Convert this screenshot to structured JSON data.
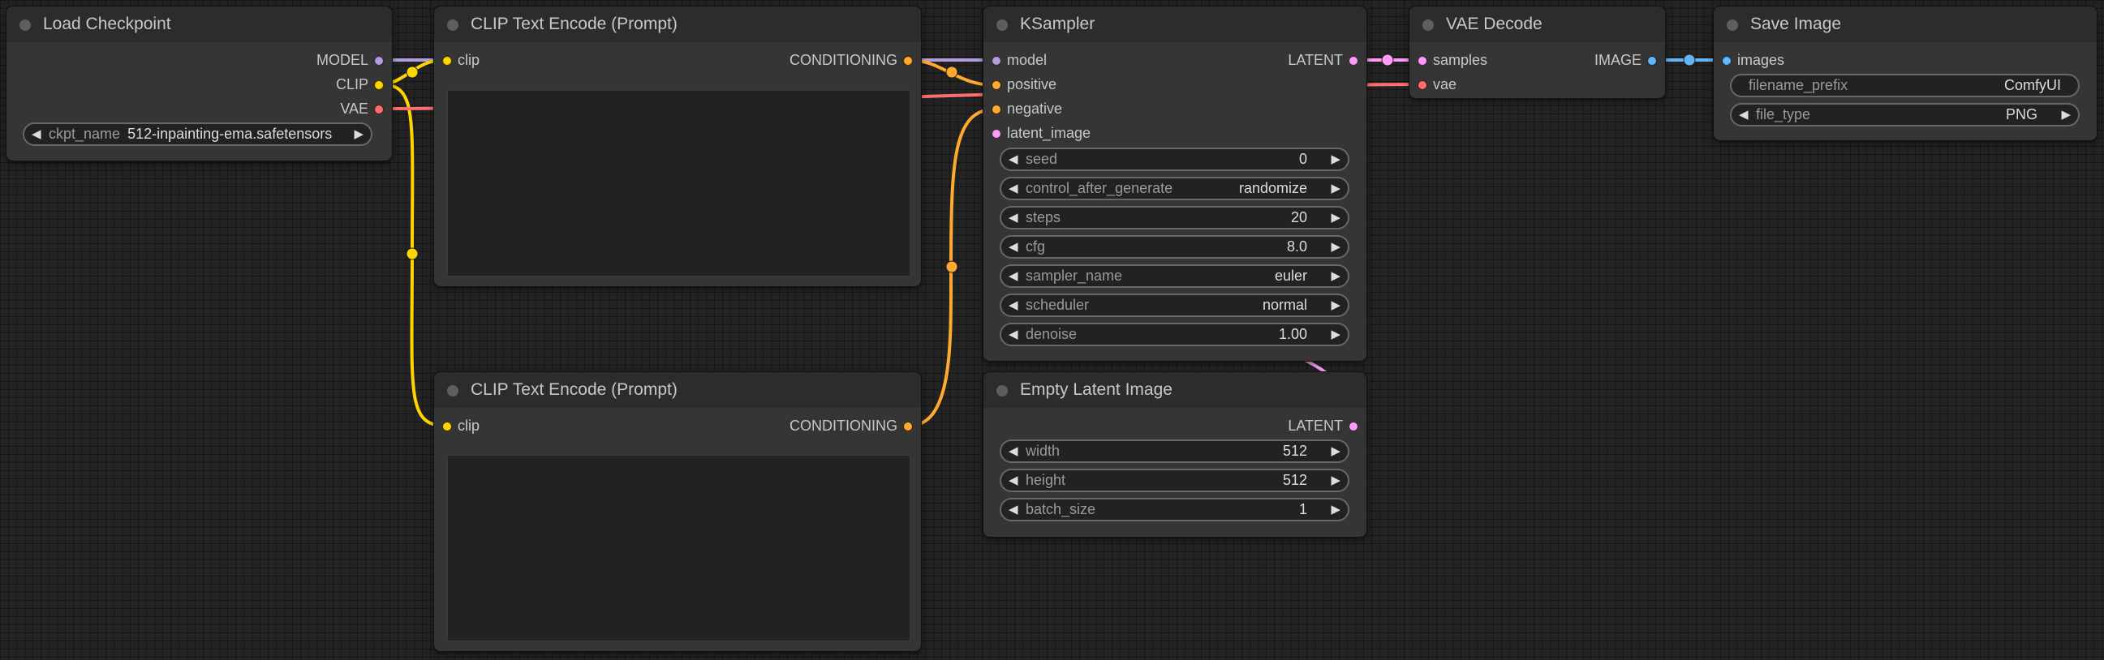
{
  "colors": {
    "model": "#b39ddb",
    "clip": "#ffd500",
    "vae": "#ff6e6e",
    "conditioning": "#ffa931",
    "latent": "#ff9cf9",
    "image": "#64b5f6",
    "canvas_bg": "#232323",
    "node_bg": "#353535",
    "node_title_bg": "#2c2c2c"
  },
  "nodes": {
    "load_checkpoint": {
      "title": "Load Checkpoint",
      "outputs": [
        "MODEL",
        "CLIP",
        "VAE"
      ],
      "ckpt_label": "ckpt_name",
      "ckpt_value": "512-inpainting-ema.safetensors"
    },
    "clip_pos": {
      "title": "CLIP Text Encode (Prompt)",
      "input": "clip",
      "output": "CONDITIONING",
      "text": ""
    },
    "clip_neg": {
      "title": "CLIP Text Encode (Prompt)",
      "input": "clip",
      "output": "CONDITIONING",
      "text": ""
    },
    "ksampler": {
      "title": "KSampler",
      "inputs": [
        "model",
        "positive",
        "negative",
        "latent_image"
      ],
      "output": "LATENT",
      "widgets": [
        {
          "label": "seed",
          "value": "0"
        },
        {
          "label": "control_after_generate",
          "value": "randomize"
        },
        {
          "label": "steps",
          "value": "20"
        },
        {
          "label": "cfg",
          "value": "8.0"
        },
        {
          "label": "sampler_name",
          "value": "euler"
        },
        {
          "label": "scheduler",
          "value": "normal"
        },
        {
          "label": "denoise",
          "value": "1.00"
        }
      ]
    },
    "empty_latent": {
      "title": "Empty Latent Image",
      "output": "LATENT",
      "widgets": [
        {
          "label": "width",
          "value": "512"
        },
        {
          "label": "height",
          "value": "512"
        },
        {
          "label": "batch_size",
          "value": "1"
        }
      ]
    },
    "vae_decode": {
      "title": "VAE Decode",
      "inputs": [
        "samples",
        "vae"
      ],
      "output": "IMAGE"
    },
    "save_image": {
      "title": "Save Image",
      "input": "images",
      "prefix_label": "filename_prefix",
      "prefix_value": "ComfyUI",
      "filetype_label": "file_type",
      "filetype_value": "PNG"
    }
  }
}
